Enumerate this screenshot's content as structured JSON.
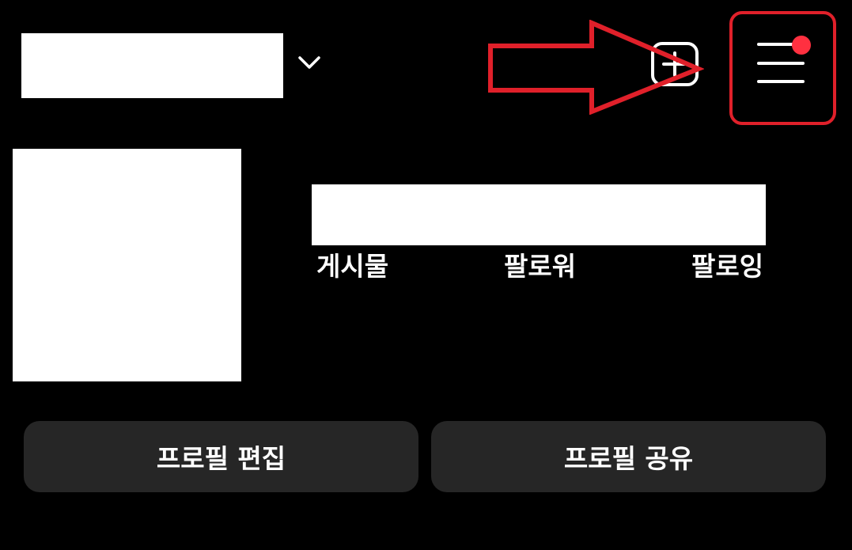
{
  "header": {
    "username_redacted": true,
    "account_switcher_icon": "chevron-down-icon",
    "new_post_icon": "plus-square-icon",
    "menu_icon": "hamburger-menu-icon",
    "notification_dot_color": "#ff3040"
  },
  "annotations": {
    "arrow_color": "#e0202a",
    "highlight_color": "#e0202a"
  },
  "profile": {
    "avatar_redacted": true,
    "stats_values_redacted": true,
    "stats": {
      "posts_label": "게시물",
      "followers_label": "팔로워",
      "following_label": "팔로잉"
    }
  },
  "actions": {
    "edit_profile_label": "프로필 편집",
    "share_profile_label": "프로필 공유"
  },
  "colors": {
    "background": "#000000",
    "button_bg": "#262626",
    "text": "#ffffff"
  }
}
